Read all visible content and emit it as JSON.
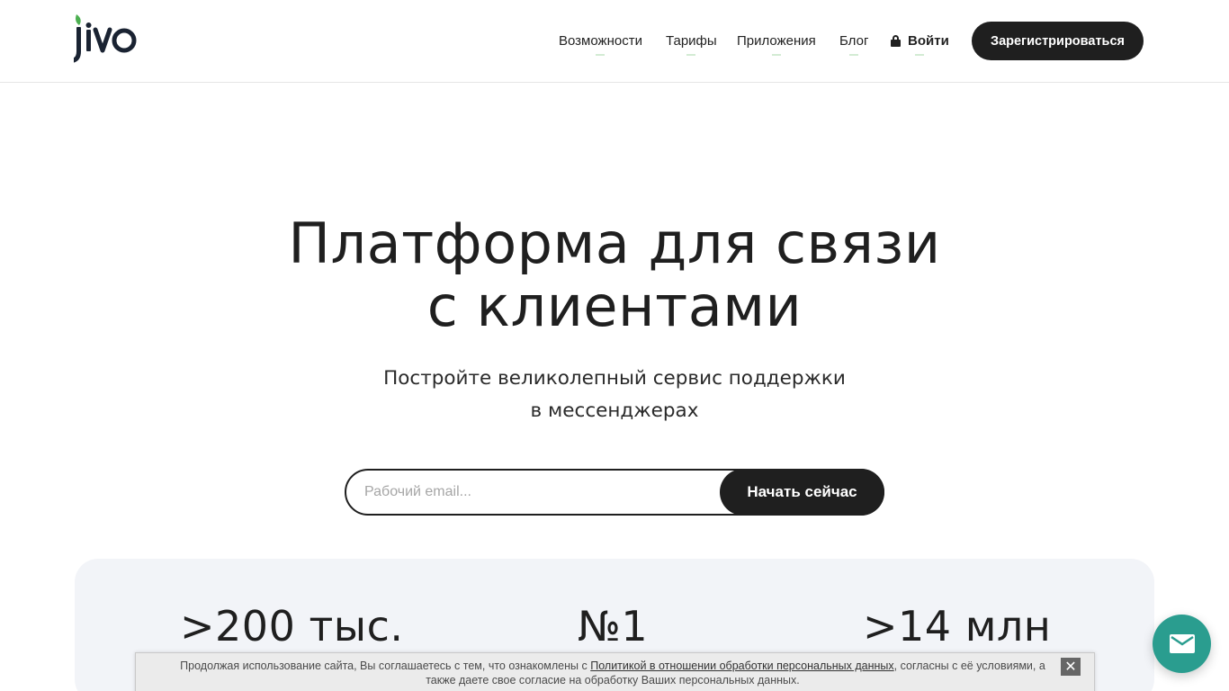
{
  "header": {
    "logo_text": "jivo",
    "nav": [
      {
        "label": "Возможности"
      },
      {
        "label": "Тарифы"
      },
      {
        "label": "Приложения"
      },
      {
        "label": "Блог"
      }
    ],
    "login_label": "Войти",
    "login_icon": "lock-icon",
    "register_label": "Зарегистрироваться"
  },
  "hero": {
    "title_line1": "Платформа для связи",
    "title_line2": "с клиентами",
    "subtitle_line1": "Постройте великолепный сервис поддержки",
    "subtitle_line2": "в мессенджерах",
    "email_placeholder": "Рабочий email...",
    "email_value": "",
    "cta_label": "Начать сейчас"
  },
  "stats": [
    {
      "value": ">200 тыс."
    },
    {
      "value": "№1"
    },
    {
      "value": ">14 млн"
    }
  ],
  "cookie": {
    "text_before": "Продолжая использование сайта, Вы соглашаетесь с тем, что ознакомлены с ",
    "link": "Политикой в отношении обработки персональных данных",
    "text_after": ", согласны с её условиями, а также даете свое согласие на обработку Ваших персональных данных.",
    "close_label": "✕"
  },
  "chat_widget": {
    "icon": "mail-icon"
  },
  "colors": {
    "primary_dark": "#1f1f1f",
    "logo_leaf": "#4caf50",
    "chat_teal": "#2a9d8f",
    "stats_bg": "#f2f4f8"
  }
}
